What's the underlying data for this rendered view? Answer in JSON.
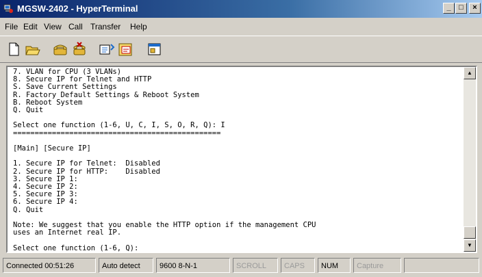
{
  "window": {
    "title": "MGSW-2402 - HyperTerminal"
  },
  "menu": [
    "File",
    "Edit",
    "View",
    "Call",
    "Transfer",
    "Help"
  ],
  "toolbar": {
    "buttons": [
      "new-icon",
      "open-icon",
      "phone-icon",
      "disconnect-icon",
      "send-icon",
      "receive-icon",
      "properties-icon"
    ]
  },
  "terminal": {
    "lines": [
      "7. VLAN for CPU (3 VLANs)",
      "8. Secure IP for Telnet and HTTP",
      "S. Save Current Settings",
      "R. Factory Default Settings & Reboot System",
      "B. Reboot System",
      "Q. Quit",
      "",
      "Select one function (1-6, U, C, I, S, O, R, Q): I",
      "================================================",
      "",
      "[Main] [Secure IP]",
      "",
      "1. Secure IP for Telnet:  Disabled",
      "2. Secure IP for HTTP:    Disabled",
      "3. Secure IP 1:",
      "4. Secure IP 2:",
      "5. Secure IP 3:",
      "6. Secure IP 4:",
      "Q. Quit",
      "",
      "Note: We suggest that you enable the HTTP option if the management CPU",
      "uses an Internet real IP.",
      "",
      "Select one function (1-6, Q): _"
    ]
  },
  "status": {
    "connected": "Connected 00:51:26",
    "detect": "Auto detect",
    "settings": "9600 8-N-1",
    "scroll": "SCROLL",
    "caps": "CAPS",
    "num": "NUM",
    "capture": "Capture"
  },
  "colors": {
    "title_start": "#0a246a",
    "title_end": "#a6caf0",
    "chrome": "#d4d0c8"
  }
}
